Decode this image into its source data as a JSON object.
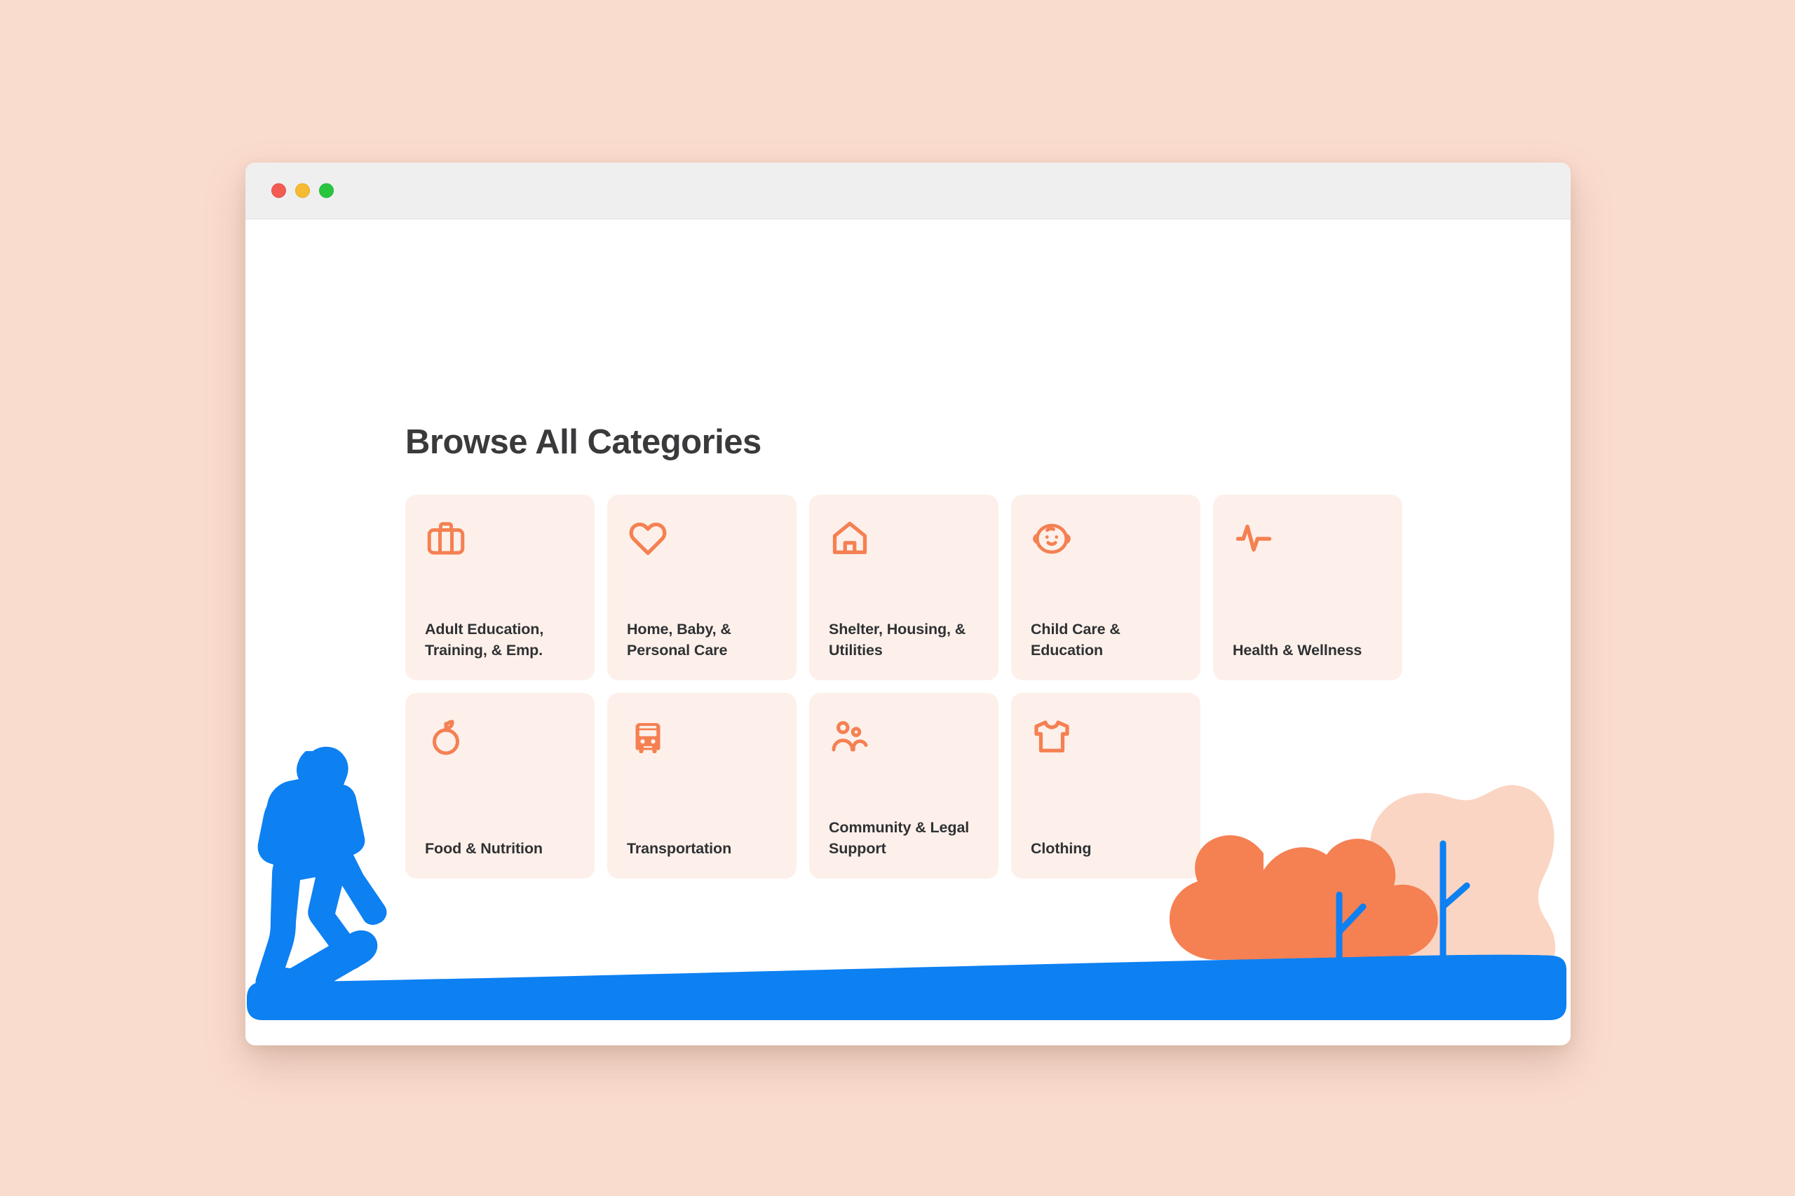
{
  "window": {
    "controls": [
      {
        "name": "close",
        "color": "#f45b52"
      },
      {
        "name": "minimize",
        "color": "#f6bb32"
      },
      {
        "name": "maximize",
        "color": "#28c63f"
      }
    ]
  },
  "page": {
    "title": "Browse All Categories",
    "background_color": "#fadcce",
    "surface_color": "#ffffff",
    "card_color": "#fdf0ea",
    "accent_color": "#f58052",
    "text_color": "#2f3134",
    "illustration_blue": "#0d80f2",
    "illustration_orange": "#f58052",
    "illustration_peach": "#fbd5c3"
  },
  "categories": [
    {
      "label": "Adult Education, Training, & Emp.",
      "icon": "briefcase-icon"
    },
    {
      "label": "Home, Baby, & Personal Care",
      "icon": "heart-icon"
    },
    {
      "label": "Shelter, Housing, & Utilities",
      "icon": "house-icon"
    },
    {
      "label": "Child Care & Education",
      "icon": "baby-face-icon"
    },
    {
      "label": "Health & Wellness",
      "icon": "pulse-icon"
    },
    {
      "label": "Food & Nutrition",
      "icon": "apple-icon"
    },
    {
      "label": "Transportation",
      "icon": "bus-icon"
    },
    {
      "label": "Community & Legal Support",
      "icon": "people-icon"
    },
    {
      "label": "Clothing",
      "icon": "tshirt-icon"
    }
  ]
}
